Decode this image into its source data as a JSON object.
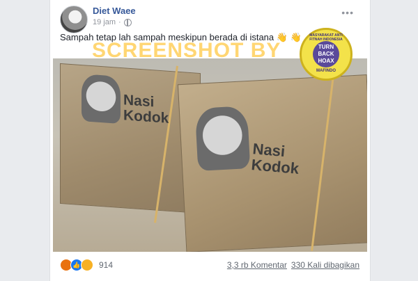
{
  "post": {
    "author": "Diet Waee",
    "time": "19 jam",
    "text": "Sampah tetap lah sampah meskipun berada di istana",
    "text_emoji": "👋 👋",
    "more": "•••"
  },
  "image": {
    "watermark": "SCREENSHOT BY",
    "parcel_label_1_line1": "Nasi",
    "parcel_label_1_line2": "Kodok",
    "parcel_label_2_line1": "Nasi",
    "parcel_label_2_line2": "Kodok",
    "badge": {
      "inner_line1": "TURN",
      "inner_line2": "BACK",
      "inner_line3": "HOAX",
      "ring_top": "MASYARAKAT ANTI FITNAH INDONESIA",
      "ring_bottom": "MAFINDO"
    }
  },
  "footer": {
    "reaction_count": "914",
    "comments": "3,3 rb Komentar",
    "shares": "330 Kali dibagikan"
  },
  "colors": {
    "author": "#365899",
    "meta": "#90949c",
    "background": "#e9ebee"
  }
}
